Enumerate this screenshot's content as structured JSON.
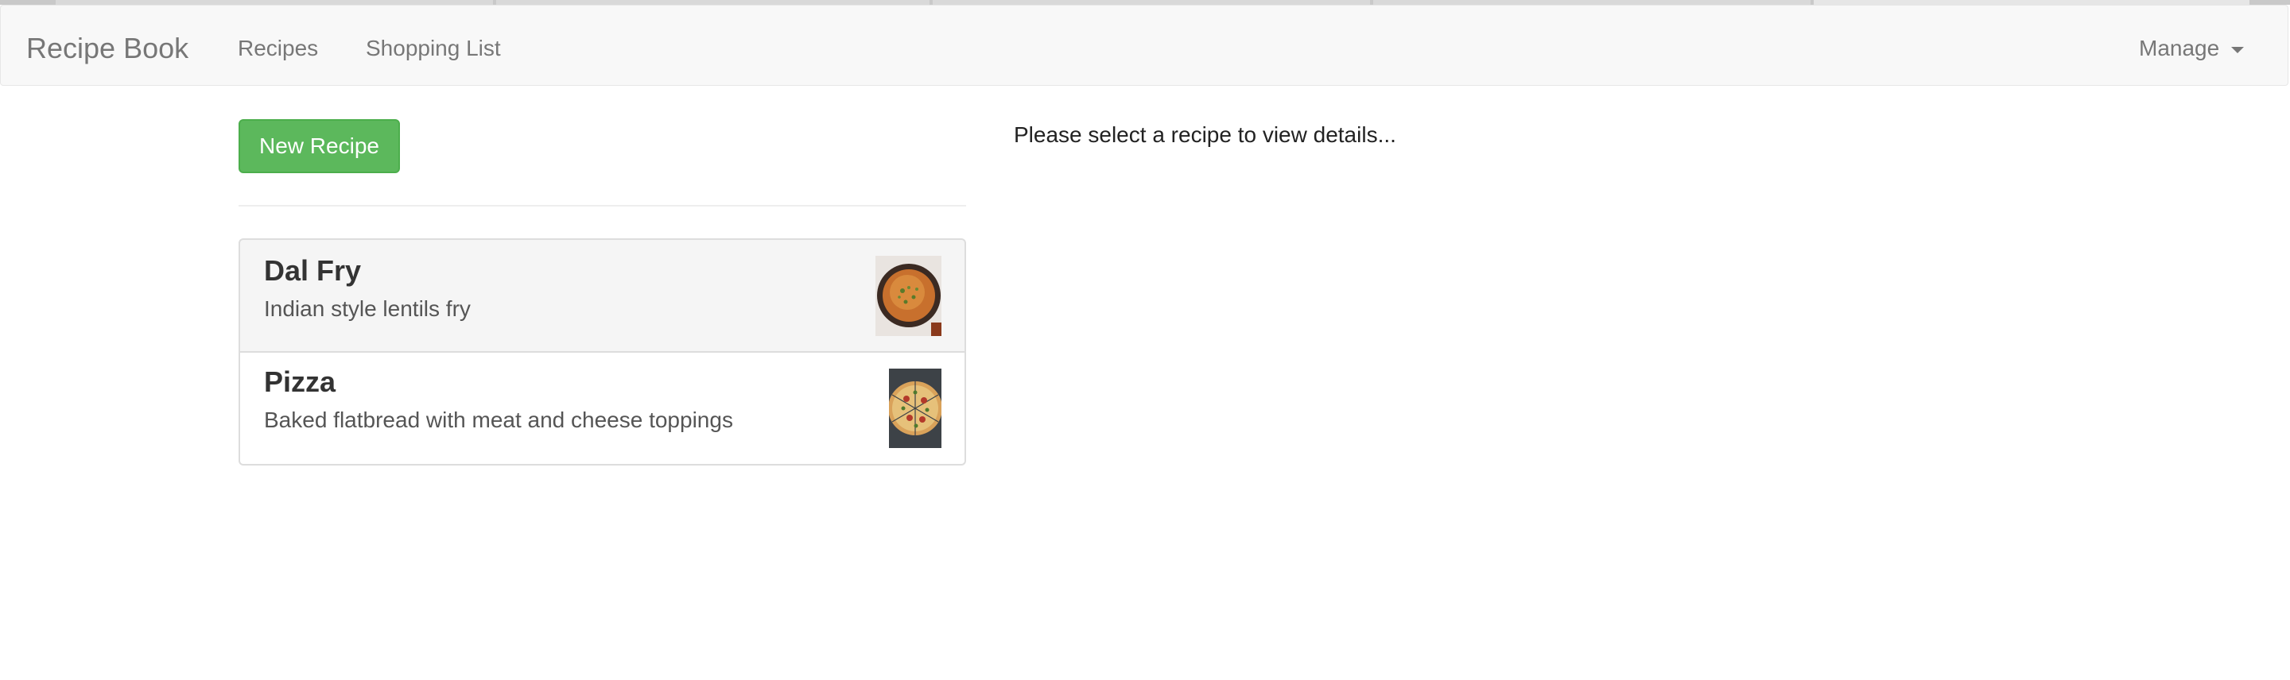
{
  "app": {
    "brand": "Recipe Book"
  },
  "nav": {
    "items": [
      {
        "label": "Recipes"
      },
      {
        "label": "Shopping List"
      }
    ],
    "manage_label": "Manage"
  },
  "toolbar": {
    "new_recipe_label": "New Recipe"
  },
  "recipes": [
    {
      "name": "Dal Fry",
      "description": "Indian style lentils fry",
      "image": "bowl-of-dal-image"
    },
    {
      "name": "Pizza",
      "description": "Baked flatbread with meat and cheese toppings",
      "image": "pizza-image"
    }
  ],
  "detail": {
    "placeholder": "Please select a recipe to view details..."
  },
  "colors": {
    "navbar_bg": "#f8f8f8",
    "nav_text": "#777777",
    "primary_success": "#5cb85c",
    "selected_item_bg": "#f5f5f5"
  }
}
